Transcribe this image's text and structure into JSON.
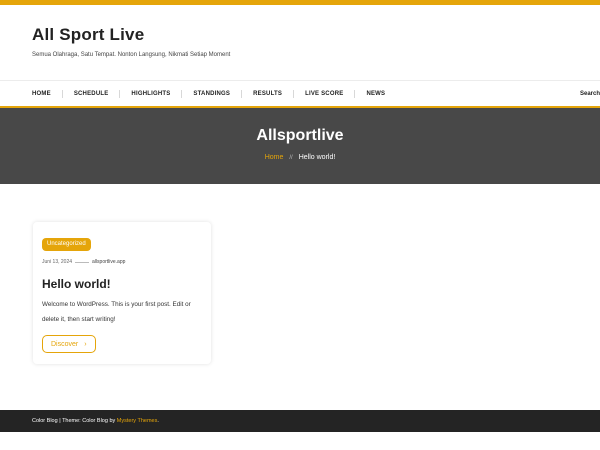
{
  "header": {
    "site_title": "All Sport Live",
    "tagline": "Semua Olahraga, Satu Tempat. Nonton Langsung, Nikmati Setiap Moment"
  },
  "nav": {
    "items": [
      {
        "label": "HOME"
      },
      {
        "label": "SCHEDULE"
      },
      {
        "label": "HIGHLIGHTS"
      },
      {
        "label": "STANDINGS"
      },
      {
        "label": "RESULTS"
      },
      {
        "label": "LIVE SCORE"
      },
      {
        "label": "NEWS"
      }
    ],
    "search_label": "Search"
  },
  "banner": {
    "title": "Allsportlive",
    "breadcrumb_home": "Home",
    "breadcrumb_sep": "//",
    "breadcrumb_current": "Hello world!"
  },
  "post": {
    "category": "Uncategorized",
    "date": "Juni 13, 2024",
    "author": "allsportlive.app",
    "title": "Hello world!",
    "excerpt": "Welcome to WordPress. This is your first post. Edit or delete it, then start writing!",
    "button_label": "Discover",
    "button_icon": "arrow-right-icon"
  },
  "footer": {
    "prefix": "Color Blog | Theme: Color Blog by ",
    "link_text": "Mystery Themes",
    "suffix": "."
  },
  "colors": {
    "accent": "#e5a50a",
    "banner_bg": "#484848",
    "footer_bg": "#242424"
  }
}
